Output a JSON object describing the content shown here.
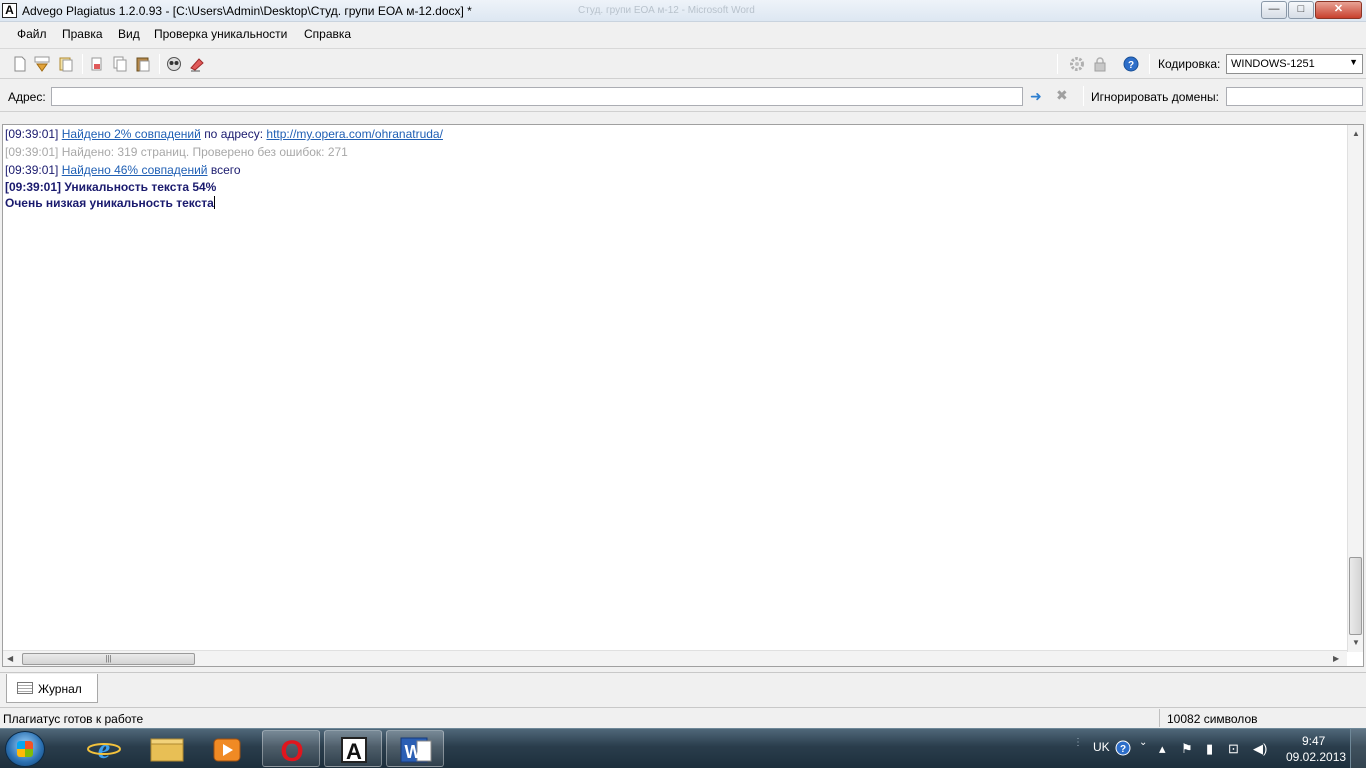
{
  "window": {
    "title": "Advego Plagiatus 1.2.0.93 - [C:\\Users\\Admin\\Desktop\\Студ. групи ЕОА м-12.docx] *",
    "ghost_title": "Студ. групи ЕОА м-12 - Microsoft Word",
    "app_icon_letter": "A",
    "min_glyph": "—",
    "max_glyph": "□",
    "close_glyph": "✕"
  },
  "menu": {
    "items": [
      "Файл",
      "Правка",
      "Вид",
      "Проверка уникальности",
      "Справка"
    ]
  },
  "toolbar": {
    "buttons": [
      "new-document-icon",
      "html-icon",
      "open-icon",
      "cut-icon",
      "copy-icon",
      "paste-icon",
      "check-icon",
      "clear-icon"
    ],
    "right_buttons": [
      "settings-icon",
      "lock-icon",
      "help-icon"
    ],
    "help_glyph": "?",
    "encoding_label": "Кодировка:",
    "encoding_value": "WINDOWS-1251"
  },
  "address": {
    "label": "Адрес:",
    "value": "",
    "go_glyph": "➜",
    "stop_glyph": "✖",
    "ignore_domains_label": "Игнорировать домены:",
    "ignore_domains_value": ""
  },
  "log": {
    "line1": {
      "time": "[09:39:01]",
      "link": "Найдено 2% совпадений",
      "text": "по адресу:",
      "url": "http://my.opera.com/ohranatruda/"
    },
    "line2": {
      "time": "[09:39:01]",
      "text": "Найдено: 319 страниц. Проверено без ошибок: 271"
    },
    "line3": {
      "time": "[09:39:01]",
      "link": "Найдено 46% совпадений",
      "text": "всего"
    },
    "line4": {
      "time": "[09:39:01]",
      "text": "Уникальность текста 54%"
    },
    "line5": {
      "text": "Очень низкая уникальность текста"
    }
  },
  "tabs": [
    {
      "label": "Журнал"
    }
  ],
  "status": {
    "left": "Плагиатус готов к работе",
    "right": "10082 символов"
  },
  "taskbar": {
    "apps": [
      "internet-explorer-icon",
      "file-explorer-icon",
      "media-player-icon",
      "opera-icon",
      "advego-icon",
      "word-icon"
    ],
    "ie_glyph": "e",
    "opera_glyph": "O",
    "advego_glyph": "A",
    "word_glyph": "W",
    "tray_lang": "UK",
    "tray_help_glyph": "?",
    "clock_time": "9:47",
    "clock_date": "09.02.2013"
  },
  "colors": {
    "link": "#1f5fb4",
    "dim": "#a8a8a8",
    "result": "#1a1a6e"
  }
}
